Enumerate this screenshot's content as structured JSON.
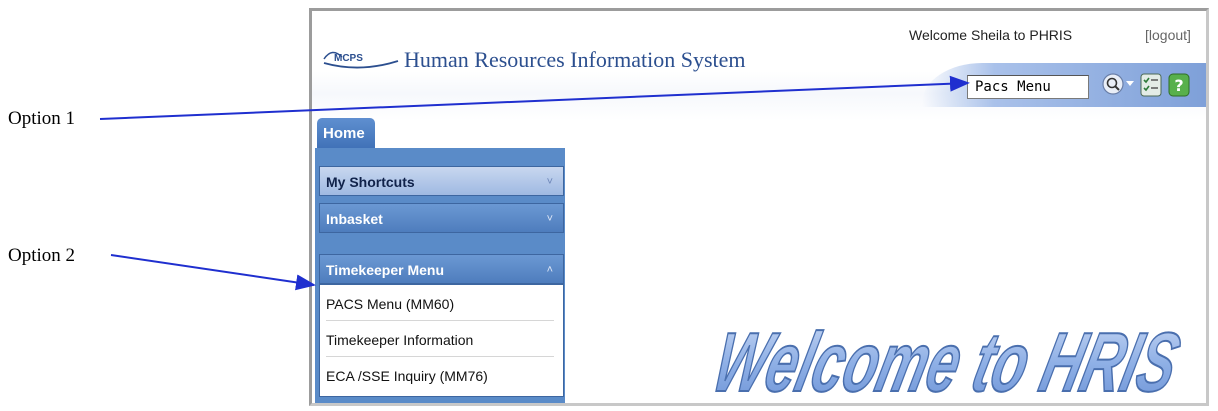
{
  "annotations": {
    "option1": "Option 1",
    "option2": "Option 2"
  },
  "header": {
    "logo_text": "MCPS",
    "title": "Human Resources Information System",
    "welcome": "Welcome Sheila to PHRIS",
    "logout": "[logout]",
    "search_value": "Pacs Menu"
  },
  "nav": {
    "home_tab": "Home",
    "sections": [
      {
        "label": "My Shortcuts",
        "chevron": "˅"
      },
      {
        "label": "Inbasket",
        "chevron": "˅"
      },
      {
        "label": "Timekeeper Menu",
        "chevron": "˄"
      }
    ],
    "timekeeper_items": [
      "PACS Menu (MM60)",
      "Timekeeper Information",
      "ECA /SSE Inquiry (MM76)"
    ]
  },
  "banner": {
    "text": "Welcome to HRIS"
  },
  "colors": {
    "title_blue": "#2c4f8f",
    "sidebar_blue": "#5a8bc8",
    "arrow_blue": "#1f2fcf",
    "banner_fill": "#8fb0e6"
  }
}
